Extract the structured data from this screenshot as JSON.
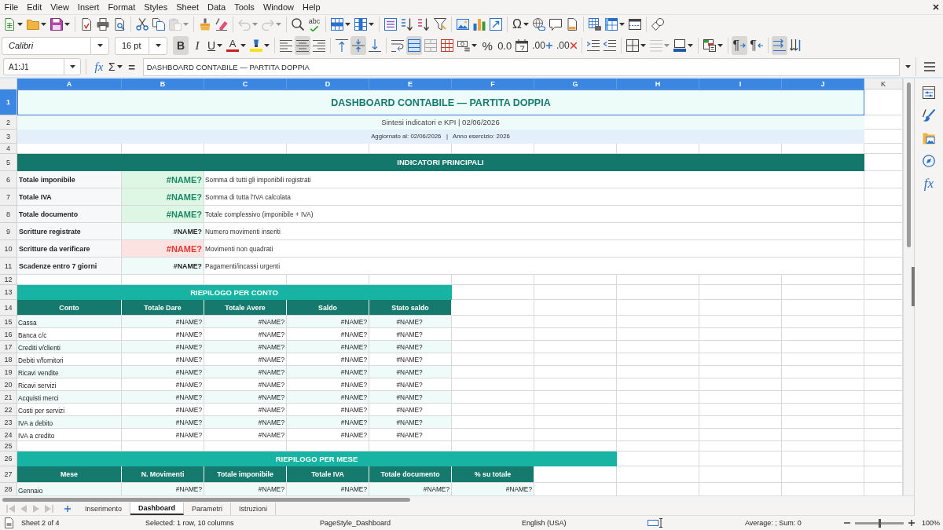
{
  "menu_bar": {
    "items": [
      "File",
      "Edit",
      "View",
      "Insert",
      "Format",
      "Styles",
      "Sheet",
      "Data",
      "Tools",
      "Window",
      "Help"
    ]
  },
  "standard_toolbar": {
    "items": [
      {
        "kind": "new",
        "dropdown": true,
        "disabled": false
      },
      {
        "kind": "open",
        "dropdown": true,
        "disabled": false
      },
      {
        "kind": "save",
        "dropdown": true,
        "disabled": false
      },
      {
        "kind": "separator"
      },
      {
        "kind": "export-pdf",
        "dropdown": false,
        "disabled": false
      },
      {
        "kind": "print",
        "dropdown": false,
        "disabled": false
      },
      {
        "kind": "print-preview",
        "dropdown": false,
        "disabled": false
      },
      {
        "kind": "separator"
      },
      {
        "kind": "cut",
        "dropdown": false,
        "disabled": false
      },
      {
        "kind": "copy",
        "dropdown": false,
        "disabled": false
      },
      {
        "kind": "paste",
        "dropdown": true,
        "disabled": true
      },
      {
        "kind": "separator"
      },
      {
        "kind": "clone-formatting",
        "dropdown": false,
        "disabled": false
      },
      {
        "kind": "clear-formatting",
        "dropdown": false,
        "disabled": false
      },
      {
        "kind": "separator"
      },
      {
        "kind": "undo",
        "dropdown": true,
        "disabled": true
      },
      {
        "kind": "redo",
        "dropdown": true,
        "disabled": true
      },
      {
        "kind": "separator"
      },
      {
        "kind": "find-replace",
        "dropdown": false,
        "disabled": false
      },
      {
        "kind": "spelling",
        "text": "abc",
        "dropdown": false,
        "disabled": false
      },
      {
        "kind": "separator"
      },
      {
        "kind": "rows",
        "dropdown": true,
        "disabled": false
      },
      {
        "kind": "columns",
        "dropdown": true,
        "disabled": false
      },
      {
        "kind": "separator"
      },
      {
        "kind": "sort",
        "dropdown": false,
        "disabled": false
      },
      {
        "kind": "sort-ascending",
        "dropdown": false,
        "disabled": false
      },
      {
        "kind": "sort-descending",
        "dropdown": false,
        "disabled": false
      },
      {
        "kind": "autofilter",
        "dropdown": false,
        "disabled": false
      },
      {
        "kind": "separator"
      },
      {
        "kind": "image",
        "dropdown": false,
        "disabled": false
      },
      {
        "kind": "chart",
        "dropdown": false,
        "disabled": false
      },
      {
        "kind": "pivot-table",
        "dropdown": false,
        "disabled": false
      },
      {
        "kind": "separator"
      },
      {
        "kind": "special-character",
        "text": "Ω",
        "dropdown": true,
        "disabled": false
      },
      {
        "kind": "hyperlink",
        "dropdown": false,
        "disabled": false
      },
      {
        "kind": "comment",
        "dropdown": false,
        "disabled": false
      },
      {
        "kind": "header-footer",
        "dropdown": false,
        "disabled": false
      },
      {
        "kind": "separator"
      },
      {
        "kind": "print-area",
        "dropdown": false,
        "disabled": false
      },
      {
        "kind": "freeze",
        "dropdown": true,
        "disabled": false
      },
      {
        "kind": "split-window",
        "dropdown": false,
        "disabled": false
      },
      {
        "kind": "separator"
      },
      {
        "kind": "draw-functions",
        "dropdown": false,
        "disabled": false
      }
    ]
  },
  "formatting_toolbar": {
    "font_name": "Calibri",
    "font_size": "16 pt",
    "items": [
      {
        "kind": "bold",
        "text": "B",
        "on": true,
        "dropdown": false,
        "disabled": false
      },
      {
        "kind": "italic",
        "text": "I",
        "on": false,
        "dropdown": false,
        "disabled": false
      },
      {
        "kind": "underline",
        "text": "U",
        "on": false,
        "dropdown": true,
        "disabled": false
      },
      {
        "kind": "font-color",
        "text": "A",
        "on": false,
        "dropdown": true,
        "disabled": false
      },
      {
        "kind": "highlight",
        "on": false,
        "dropdown": true,
        "disabled": false
      },
      {
        "kind": "separator"
      },
      {
        "kind": "align-left",
        "on": false,
        "dropdown": false,
        "disabled": false
      },
      {
        "kind": "align-center",
        "on": true,
        "dropdown": false,
        "disabled": false
      },
      {
        "kind": "align-right",
        "on": false,
        "dropdown": false,
        "disabled": false
      },
      {
        "kind": "separator"
      },
      {
        "kind": "align-top",
        "on": false,
        "dropdown": false,
        "disabled": false
      },
      {
        "kind": "align-middle",
        "on": true,
        "dropdown": false,
        "disabled": false
      },
      {
        "kind": "align-bottom",
        "on": false,
        "dropdown": false,
        "disabled": false
      },
      {
        "kind": "separator"
      },
      {
        "kind": "wrap-text",
        "on": false,
        "dropdown": false,
        "disabled": false
      },
      {
        "kind": "merge-center",
        "on": true,
        "dropdown": false,
        "disabled": false
      },
      {
        "kind": "merge",
        "on": false,
        "dropdown": false,
        "disabled": false
      },
      {
        "kind": "unmerge",
        "on": false,
        "dropdown": false,
        "disabled": false
      },
      {
        "kind": "currency",
        "on": false,
        "dropdown": true,
        "disabled": false
      },
      {
        "kind": "percent",
        "text": "%",
        "on": false,
        "dropdown": false,
        "disabled": false
      },
      {
        "kind": "number-standard",
        "text": "0.0",
        "on": false,
        "dropdown": false,
        "disabled": false
      },
      {
        "kind": "date",
        "on": false,
        "dropdown": false,
        "disabled": false
      },
      {
        "kind": "add-decimal",
        "text": ".00",
        "on": false,
        "dropdown": false,
        "disabled": false
      },
      {
        "kind": "delete-decimal",
        "text": ".00",
        "on": false,
        "dropdown": false,
        "disabled": false
      },
      {
        "kind": "separator"
      },
      {
        "kind": "indent-increase",
        "on": false,
        "dropdown": false,
        "disabled": false
      },
      {
        "kind": "indent-decrease",
        "on": false,
        "dropdown": false,
        "disabled": false
      },
      {
        "kind": "separator"
      },
      {
        "kind": "borders",
        "on": false,
        "dropdown": true,
        "disabled": false
      },
      {
        "kind": "border-style",
        "on": false,
        "dropdown": true,
        "disabled": true
      },
      {
        "kind": "border-color",
        "on": false,
        "dropdown": true,
        "disabled": false
      },
      {
        "kind": "separator"
      },
      {
        "kind": "conditional",
        "on": false,
        "dropdown": true,
        "disabled": false
      },
      {
        "kind": "separator"
      },
      {
        "kind": "left-to-right",
        "text": "¶",
        "on": true,
        "dropdown": false,
        "disabled": false
      },
      {
        "kind": "right-to-left",
        "text": "¶",
        "on": false,
        "dropdown": false,
        "disabled": false
      },
      {
        "kind": "separator"
      },
      {
        "kind": "text-horizontal",
        "on": true,
        "dropdown": false,
        "disabled": false
      },
      {
        "kind": "text-vertical",
        "on": false,
        "dropdown": false,
        "disabled": false
      }
    ]
  },
  "formula_bar": {
    "name_box": "A1:J1",
    "buttons": [
      {
        "kind": "function-wizard",
        "text": "fx",
        "dropdown": false
      },
      {
        "kind": "sum",
        "text": "Σ",
        "dropdown": true
      },
      {
        "kind": "formula",
        "text": "=",
        "dropdown": false
      }
    ],
    "value": "DASHBOARD CONTABILE — PARTITA DOPPIA"
  },
  "sheet": {
    "column_headers": [
      {
        "label": "A",
        "selected": true
      },
      {
        "label": "B",
        "selected": true
      },
      {
        "label": "C",
        "selected": true
      },
      {
        "label": "D",
        "selected": true
      },
      {
        "label": "E",
        "selected": true
      },
      {
        "label": "F",
        "selected": true
      },
      {
        "label": "G",
        "selected": true
      },
      {
        "label": "H",
        "selected": true
      },
      {
        "label": "I",
        "selected": true
      },
      {
        "label": "J",
        "selected": true
      },
      {
        "label": "K",
        "selected": false
      }
    ],
    "row_headers": [
      {
        "label": "1",
        "selected": true
      },
      {
        "label": "2",
        "selected": false
      },
      {
        "label": "3",
        "selected": false
      },
      {
        "label": "4",
        "selected": false
      },
      {
        "label": "5",
        "selected": false
      },
      {
        "label": "6",
        "selected": false
      },
      {
        "label": "7",
        "selected": false
      },
      {
        "label": "8",
        "selected": false
      },
      {
        "label": "9",
        "selected": false
      },
      {
        "label": "10",
        "selected": false
      },
      {
        "label": "11",
        "selected": false
      },
      {
        "label": "12",
        "selected": false
      },
      {
        "label": "13",
        "selected": false
      },
      {
        "label": "14",
        "selected": false
      },
      {
        "label": "15",
        "selected": false
      },
      {
        "label": "16",
        "selected": false
      },
      {
        "label": "17",
        "selected": false
      },
      {
        "label": "18",
        "selected": false
      },
      {
        "label": "19",
        "selected": false
      },
      {
        "label": "20",
        "selected": false
      },
      {
        "label": "21",
        "selected": false
      },
      {
        "label": "22",
        "selected": false
      },
      {
        "label": "23",
        "selected": false
      },
      {
        "label": "24",
        "selected": false
      },
      {
        "label": "25",
        "selected": false
      },
      {
        "label": "26",
        "selected": false
      },
      {
        "label": "27",
        "selected": false
      },
      {
        "label": "28",
        "selected": false
      }
    ],
    "title": {
      "text": "DASHBOARD CONTABILE — PARTITA DOPPIA",
      "selected": true
    },
    "subtitle": "Sintesi indicatori e KPI | 02/06/2026",
    "info": "Aggiornato al: 02/06/2026   |   Anno esercizio: 2026",
    "indicators": {
      "heading": "INDICATORI PRINCIPALI",
      "rows": [
        {
          "label": "Totale imponibile",
          "value": "#NAME?",
          "note": "Somma di tutti gli imponibili registrati",
          "kind": "total"
        },
        {
          "label": "Totale IVA",
          "value": "#NAME?",
          "note": "Somma di tutta l'IVA calcolata",
          "kind": "total"
        },
        {
          "label": "Totale documento",
          "value": "#NAME?",
          "note": "Totale complessivo (imponibile + IVA)",
          "kind": "total"
        },
        {
          "label": "Scritture registrate",
          "value": "#NAME?",
          "note": "Numero movimenti inseriti",
          "kind": "count"
        },
        {
          "label": "Scritture da verificare",
          "value": "#NAME?",
          "note": "Movimenti non quadrati",
          "kind": "alert"
        },
        {
          "label": "Scadenze entro 7 giorni",
          "value": "#NAME?",
          "note": "Pagamenti/incassi urgenti",
          "kind": "count"
        }
      ]
    },
    "account_summary": {
      "heading": "RIEPILOGO PER CONTO",
      "columns": [
        "Conto",
        "Totale Dare",
        "Totale Avere",
        "Saldo",
        "Stato saldo"
      ],
      "rows": [
        [
          "Cassa",
          "#NAME?",
          "#NAME?",
          "#NAME?",
          "#NAME?"
        ],
        [
          "Banca c/c",
          "#NAME?",
          "#NAME?",
          "#NAME?",
          "#NAME?"
        ],
        [
          "Crediti v/clienti",
          "#NAME?",
          "#NAME?",
          "#NAME?",
          "#NAME?"
        ],
        [
          "Debiti v/fornitori",
          "#NAME?",
          "#NAME?",
          "#NAME?",
          "#NAME?"
        ],
        [
          "Ricavi vendite",
          "#NAME?",
          "#NAME?",
          "#NAME?",
          "#NAME?"
        ],
        [
          "Ricavi servizi",
          "#NAME?",
          "#NAME?",
          "#NAME?",
          "#NAME?"
        ],
        [
          "Acquisti merci",
          "#NAME?",
          "#NAME?",
          "#NAME?",
          "#NAME?"
        ],
        [
          "Costi per servizi",
          "#NAME?",
          "#NAME?",
          "#NAME?",
          "#NAME?"
        ],
        [
          "IVA a debito",
          "#NAME?",
          "#NAME?",
          "#NAME?",
          "#NAME?"
        ],
        [
          "IVA a credito",
          "#NAME?",
          "#NAME?",
          "#NAME?",
          "#NAME?"
        ]
      ]
    },
    "monthly_summary": {
      "heading": "RIEPILOGO PER MESE",
      "columns": [
        "Mese",
        "N. Movimenti",
        "Totale imponibile",
        "Totale IVA",
        "Totale documento",
        "% su totale"
      ],
      "rows": [
        [
          "Gennaio",
          "#NAME?",
          "#NAME?",
          "#NAME?",
          "#NAME?",
          "#NAME?"
        ]
      ]
    }
  },
  "sidebar": {
    "items": [
      {
        "kind": "properties"
      },
      {
        "kind": "styles"
      },
      {
        "kind": "gallery"
      },
      {
        "kind": "navigator"
      },
      {
        "kind": "functions",
        "text": "fx"
      }
    ]
  },
  "sheet_tabs": {
    "navigation": [
      {
        "kind": "first",
        "disabled": true
      },
      {
        "kind": "previous",
        "disabled": true
      },
      {
        "kind": "next",
        "disabled": true
      },
      {
        "kind": "last",
        "disabled": true
      }
    ],
    "tabs": [
      {
        "label": "Inserimento",
        "selected": false
      },
      {
        "label": "Dashboard",
        "selected": true
      },
      {
        "label": "Parametri",
        "selected": false
      },
      {
        "label": "Istruzioni",
        "selected": false
      }
    ]
  },
  "status_bar": {
    "sheet": "Sheet 2 of 4",
    "selection": "Selected: 1 row, 10 columns",
    "page_style": "PageStyle_Dashboard",
    "language": "English (USA)",
    "summary": "Average: ; Sum: 0",
    "zoom": {
      "level": 0.5,
      "label": "100%"
    }
  }
}
